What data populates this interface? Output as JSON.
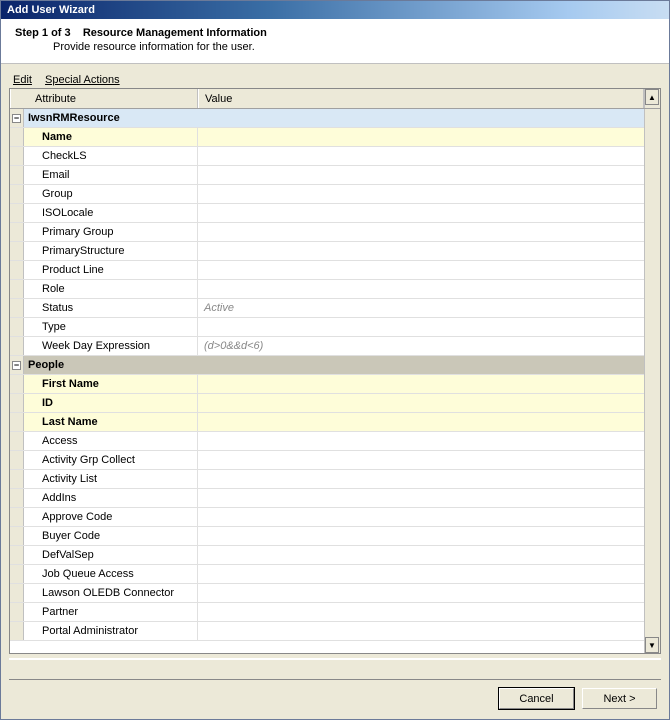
{
  "window_title": "Add User Wizard",
  "step": {
    "label": "Step 1 of 3",
    "title": "Resource Management Information",
    "subtitle": "Provide resource information for the user."
  },
  "menu": {
    "edit": "Edit",
    "special": "Special Actions"
  },
  "columns": {
    "attribute": "Attribute",
    "value": "Value"
  },
  "groups": [
    {
      "name": "IwsnRMResource",
      "rows": [
        {
          "attr": "Name",
          "required": true,
          "val": ""
        },
        {
          "attr": "CheckLS",
          "val": ""
        },
        {
          "attr": "Email",
          "val": ""
        },
        {
          "attr": "Group",
          "val": ""
        },
        {
          "attr": "ISOLocale",
          "val": ""
        },
        {
          "attr": "Primary Group",
          "val": ""
        },
        {
          "attr": "PrimaryStructure",
          "val": ""
        },
        {
          "attr": "Product Line",
          "val": ""
        },
        {
          "attr": "Role",
          "val": ""
        },
        {
          "attr": "Status",
          "val": "Active"
        },
        {
          "attr": "Type",
          "val": ""
        },
        {
          "attr": "Week Day Expression",
          "val": "(d>0&&d<6)"
        }
      ]
    },
    {
      "name": "People",
      "rows": [
        {
          "attr": "First Name",
          "required": true,
          "val": ""
        },
        {
          "attr": "ID",
          "required": true,
          "val": ""
        },
        {
          "attr": "Last Name",
          "required": true,
          "val": ""
        },
        {
          "attr": "Access",
          "val": ""
        },
        {
          "attr": "Activity Grp Collect",
          "val": ""
        },
        {
          "attr": "Activity List",
          "val": ""
        },
        {
          "attr": "AddIns",
          "val": ""
        },
        {
          "attr": "Approve Code",
          "val": ""
        },
        {
          "attr": "Buyer Code",
          "val": ""
        },
        {
          "attr": "DefValSep",
          "val": ""
        },
        {
          "attr": "Job Queue Access",
          "val": ""
        },
        {
          "attr": "Lawson OLEDB Connector",
          "val": ""
        },
        {
          "attr": "Partner",
          "val": ""
        },
        {
          "attr": "Portal Administrator",
          "val": ""
        }
      ]
    }
  ],
  "buttons": {
    "cancel": "Cancel",
    "next": "Next >"
  },
  "icons": {
    "collapse": "−",
    "up": "▲",
    "down": "▼"
  }
}
